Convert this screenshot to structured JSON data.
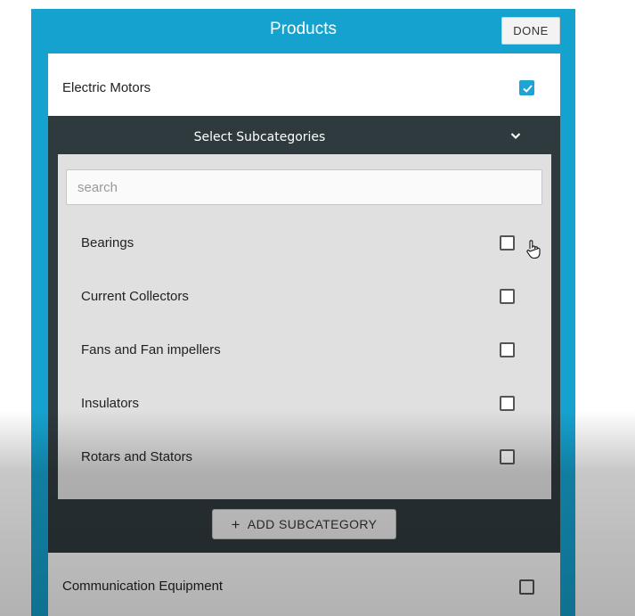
{
  "header": {
    "title": "Products",
    "done_label": "DONE"
  },
  "primary_row": {
    "label": "Electric Motors",
    "checked": true
  },
  "subcategories": {
    "title": "Select Subcategories",
    "chevron_icon": "chevron-down-icon",
    "search": {
      "placeholder": "search",
      "value": ""
    },
    "items": [
      {
        "label": "Bearings",
        "checked": false
      },
      {
        "label": "Current Collectors",
        "checked": false
      },
      {
        "label": "Fans and Fan impellers",
        "checked": false
      },
      {
        "label": "Insulators",
        "checked": false
      },
      {
        "label": "Rotars and Stators",
        "checked": false
      }
    ],
    "add_label": "ADD SUBCATEGORY",
    "add_icon": "+"
  },
  "secondary_row": {
    "label": "Communication Equipment",
    "checked": false
  },
  "colors": {
    "header_bg": "#16a2cf",
    "subpanel_bg": "#2f3a3e",
    "checkbox_on": "#1ea3d2"
  }
}
